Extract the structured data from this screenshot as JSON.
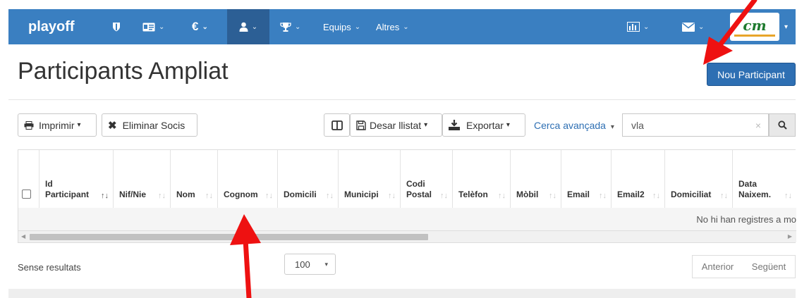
{
  "navbar": {
    "brand": "playoff",
    "items": [
      {
        "name": "shield-icon",
        "glyph": "⛊"
      },
      {
        "name": "id-card-icon",
        "glyph": "▤"
      },
      {
        "name": "euro-icon",
        "glyph": "€"
      },
      {
        "name": "user-icon",
        "glyph": "👤"
      },
      {
        "name": "trophy-icon",
        "glyph": "🏆"
      }
    ],
    "equips": "Equips",
    "altres": "Altres",
    "caret": "⌄",
    "logo": "cm",
    "colors": {
      "bar": "#3a7fc1",
      "active": "#2c5f95"
    }
  },
  "page": {
    "title": "Participants Ampliat",
    "new_button": "Nou Participant"
  },
  "toolbar": {
    "print": "Imprimir",
    "delete_members": "Eliminar Socis",
    "save_list": "Desar llistat",
    "export": "Exportar",
    "advanced_search": "Cerca avançada",
    "search_value": "vla",
    "clear": "×",
    "dropdown_caret": "▾"
  },
  "table": {
    "headers": [
      {
        "line1": "Id",
        "line2": "Participant"
      },
      {
        "line1": "",
        "line2": "Nif/Nie"
      },
      {
        "line1": "",
        "line2": "Nom"
      },
      {
        "line1": "",
        "line2": "Cognom"
      },
      {
        "line1": "",
        "line2": "Domicili"
      },
      {
        "line1": "",
        "line2": "Municipi"
      },
      {
        "line1": "Codi",
        "line2": "Postal"
      },
      {
        "line1": "",
        "line2": "Telèfon"
      },
      {
        "line1": "",
        "line2": "Mòbil"
      },
      {
        "line1": "",
        "line2": "Email"
      },
      {
        "line1": "",
        "line2": "Email2"
      },
      {
        "line1": "",
        "line2": "Domiciliat"
      },
      {
        "line1": "Data",
        "line2": "Naixem."
      }
    ],
    "empty_message": "No hi han registres a mo"
  },
  "footer": {
    "results": "Sense resultats",
    "page_size": "100",
    "prev": "Anterior",
    "next": "Següent"
  },
  "annotation_color": "#ee1111"
}
